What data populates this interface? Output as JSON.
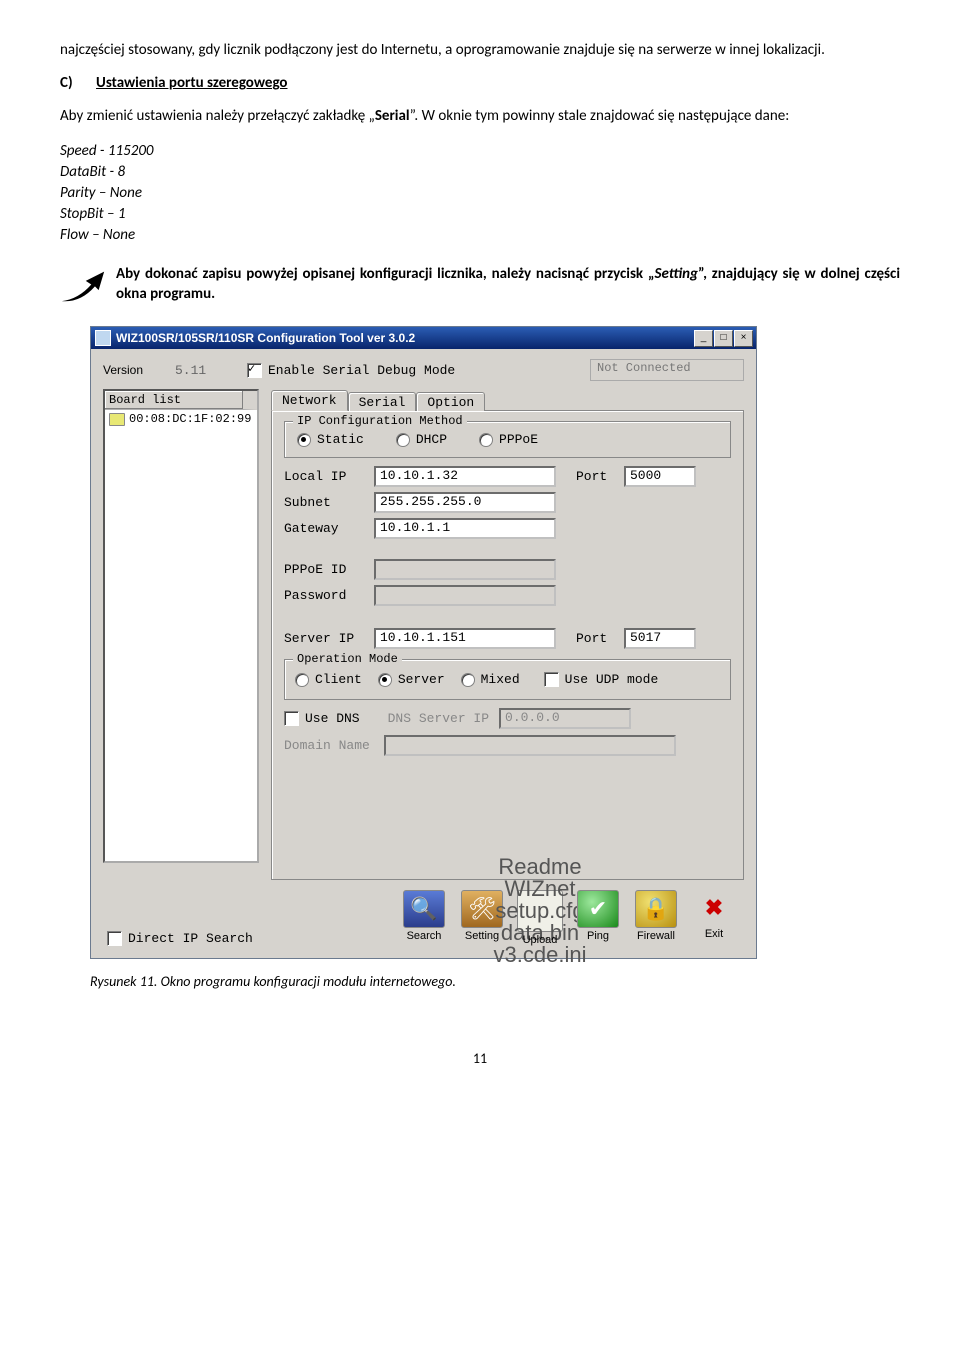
{
  "doc": {
    "para1": "najczęściej stosowany, gdy licznik podłączony jest do Internetu, a oprogramowanie znajduje się na serwerze w innej lokalizacji.",
    "section_letter": "C)",
    "section_title": "Ustawienia portu szeregowego",
    "para2_pre": "Aby zmienić ustawienia należy przełączyć zakładkę „",
    "para2_bold": "Serial",
    "para2_post": "”. W oknie tym powinny stale znajdować się następujące dane:",
    "settings": {
      "speed": "Speed  - 115200",
      "databit": "DataBit  - 8",
      "parity": "Parity – None",
      "stopbit": "StopBit – 1",
      "flow": "Flow – None"
    },
    "note_pre": "Aby dokonać zapisu powyżej opisanej konfiguracji licznika, należy nacisnąć przycisk „",
    "note_italic": "Setting",
    "note_post": "”, znajdujący się w dolnej części okna programu.",
    "caption_pre": "Rysunek 11. Okno ",
    "caption_rest": "programu konfiguracji modułu internetowego.",
    "page_number": "11"
  },
  "app": {
    "title": "WIZ100SR/105SR/110SR Configuration Tool ver 3.0.2",
    "winbtn_min": "_",
    "winbtn_max": "□",
    "winbtn_close": "×",
    "version_label": "Version",
    "version_value": "5.11",
    "debug_label": "Enable Serial Debug Mode",
    "status": "Not Connected",
    "board_list_header": "Board list",
    "board_entry": "00:08:DC:1F:02:99",
    "tabs": {
      "network": "Network",
      "serial": "Serial",
      "option": "Option"
    },
    "group_ip": "IP Configuration Method",
    "radio_static": "Static",
    "radio_dhcp": "DHCP",
    "radio_pppoe": "PPPoE",
    "labels": {
      "local_ip": "Local IP",
      "subnet": "Subnet",
      "gateway": "Gateway",
      "pppoe_id": "PPPoE ID",
      "password": "Password",
      "server_ip": "Server IP",
      "port": "Port"
    },
    "values": {
      "local_ip": "10.10.1.32",
      "subnet": "255.255.255.0",
      "gateway": "10.10.1.1",
      "pppoe_id": "",
      "password": "",
      "server_ip": "10.10.1.151",
      "port_local": "5000",
      "port_server": "5017"
    },
    "group_op": "Operation Mode",
    "radio_client": "Client",
    "radio_server": "Server",
    "radio_mixed": "Mixed",
    "chk_udp": "Use UDP mode",
    "chk_dns": "Use DNS",
    "dns_label": "DNS Server IP",
    "dns_value": "0.0.0.0",
    "domain_label": "Domain Name",
    "direct_ip": "Direct IP Search",
    "buttons": {
      "search": "Search",
      "setting": "Setting",
      "upload": "Upload",
      "ping": "Ping",
      "firewall": "Firewall",
      "exit": "Exit"
    }
  }
}
